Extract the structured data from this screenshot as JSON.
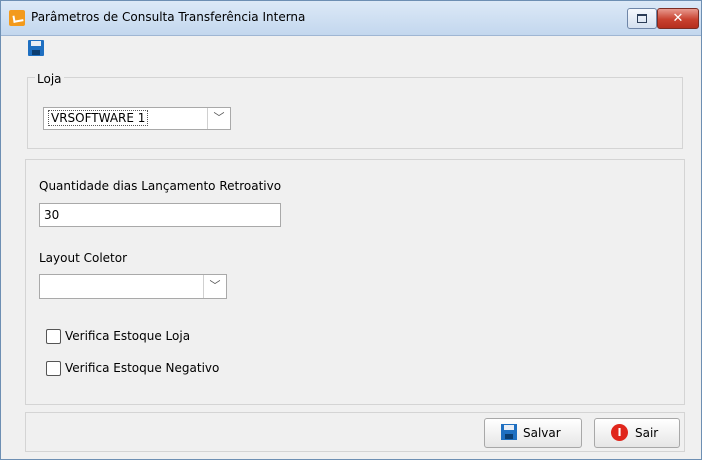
{
  "window": {
    "title": "Parâmetros de Consulta Transferência Interna",
    "close_glyph": "✕"
  },
  "loja": {
    "group_label": "Loja",
    "selected": "VRSOFTWARE 1"
  },
  "quantidade": {
    "label": "Quantidade dias Lançamento Retroativo",
    "value": "30"
  },
  "layout_coletor": {
    "label": "Layout Coletor",
    "selected": ""
  },
  "checkboxes": [
    {
      "label": "Verifica Estoque Loja",
      "checked": false
    },
    {
      "label": "Verifica Estoque Negativo",
      "checked": false
    }
  ],
  "buttons": {
    "save_label": "Salvar",
    "exit_label": "Sair",
    "exit_icon_glyph": "I"
  },
  "icons": {
    "toolbar_save": "save-icon",
    "button_save": "save-icon",
    "button_exit": "power-icon",
    "combo_arrow": "chevron-down-icon"
  },
  "colors": {
    "titlebar": "#c3d7ee",
    "close_button": "#c8412f",
    "save_icon": "#1e6fc1",
    "exit_icon": "#e0261c"
  }
}
